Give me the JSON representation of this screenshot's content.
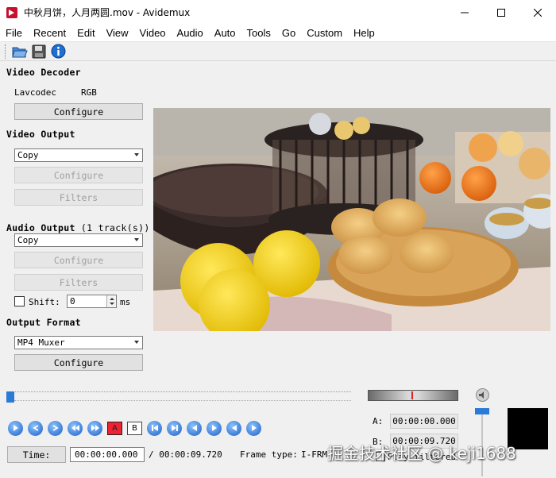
{
  "window": {
    "title": "中秋月饼，人月两圆.mov - Avidemux"
  },
  "menu": [
    "File",
    "Recent",
    "Edit",
    "View",
    "Video",
    "Audio",
    "Auto",
    "Tools",
    "Go",
    "Custom",
    "Help"
  ],
  "toolbar": {
    "icons": [
      "open-folder-icon",
      "save-disk-icon",
      "info-icon"
    ]
  },
  "video_decoder": {
    "title": "Video Decoder",
    "codec": "Lavcodec",
    "colorspace": "RGB",
    "configure_label": "Configure"
  },
  "video_output": {
    "title": "Video Output",
    "selected": "Copy",
    "configure_label": "Configure",
    "filters_label": "Filters"
  },
  "audio_output": {
    "title": "Audio Output",
    "tracks": "(1 track(s))",
    "selected": "Copy",
    "configure_label": "Configure",
    "filters_label": "Filters",
    "shift_label": "Shift:",
    "shift_value": "0",
    "shift_unit": "ms"
  },
  "output_format": {
    "title": "Output Format",
    "selected": "MP4 Muxer",
    "configure_label": "Configure"
  },
  "seek": {
    "position": 0.0
  },
  "markers": {
    "a_label": "A:",
    "a_value": "00:00:00.000",
    "b_label": "B:",
    "b_value": "00:00:09.720",
    "play_filtered": "Play filtered"
  },
  "controls": {
    "marker_a": "A",
    "marker_b": "B"
  },
  "status": {
    "time_button": "Time:",
    "current_time": "00:00:00.000",
    "total_time": "/ 00:00:09.720",
    "frame_type_label": "Frame type:",
    "frame_type_value": "I-FRM"
  },
  "watermark": "掘金技术社区 @ keji1688",
  "colors": {
    "accent": "#2a7bd6",
    "background": "#f0f0f0"
  }
}
